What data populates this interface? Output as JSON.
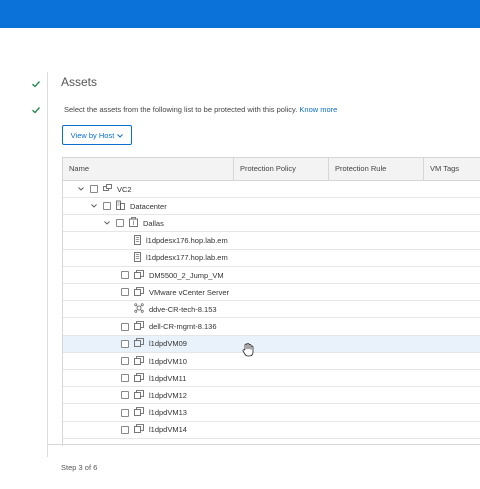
{
  "wizard": {
    "section_title": "Assets",
    "description": "Select the assets from the following list to be protected with this policy.",
    "know_more": "Know more",
    "view_by": "View by Host",
    "step": "Step 3 of 6"
  },
  "table": {
    "columns": [
      "Name",
      "Protection Policy",
      "Protection Rule",
      "VM Tags"
    ],
    "rows": [
      {
        "name": "VC2",
        "icon": "vcenter-icon",
        "checkbox": true,
        "expander": true,
        "indent": 0
      },
      {
        "name": "Datacenter",
        "icon": "datacenter-icon",
        "checkbox": true,
        "expander": true,
        "indent": 1
      },
      {
        "name": "Dallas",
        "icon": "cluster-icon",
        "checkbox": true,
        "expander": true,
        "indent": 2
      },
      {
        "name": "l1dpdesx176.hop.lab.em",
        "icon": "host-icon",
        "checkbox": false,
        "expander": false,
        "indent": 3
      },
      {
        "name": "l1dpdesx177.hop.lab.em",
        "icon": "host-icon",
        "checkbox": false,
        "expander": false,
        "indent": 3
      },
      {
        "name": "DM5500_2_Jump_VM",
        "icon": "vm-icon",
        "checkbox": true,
        "expander": false,
        "indent": 3
      },
      {
        "name": "VMware vCenter Server",
        "icon": "vm-icon",
        "checkbox": true,
        "expander": false,
        "indent": 3
      },
      {
        "name": "ddve-CR-tech-8.153",
        "icon": "ddve-icon",
        "checkbox": false,
        "expander": false,
        "indent": 3
      },
      {
        "name": "dell-CR-mgmt-8.136",
        "icon": "vm-icon",
        "checkbox": true,
        "expander": false,
        "indent": 3
      },
      {
        "name": "l1dpdVM09",
        "icon": "vm-icon",
        "checkbox": true,
        "expander": false,
        "indent": 3,
        "highlighted": true
      },
      {
        "name": "l1dpdVM10",
        "icon": "vm-icon",
        "checkbox": true,
        "expander": false,
        "indent": 3
      },
      {
        "name": "l1dpdVM11",
        "icon": "vm-icon",
        "checkbox": true,
        "expander": false,
        "indent": 3
      },
      {
        "name": "l1dpdVM12",
        "icon": "vm-icon",
        "checkbox": true,
        "expander": false,
        "indent": 3
      },
      {
        "name": "l1dpdVM13",
        "icon": "vm-icon",
        "checkbox": true,
        "expander": false,
        "indent": 3
      },
      {
        "name": "l1dpdVM14",
        "icon": "vm-icon",
        "checkbox": true,
        "expander": false,
        "indent": 3
      }
    ]
  },
  "colors": {
    "brand": "#0b72d9",
    "link": "#0b6fd0",
    "check": "#2e8b57",
    "row_highlight": "#e9f1fb"
  }
}
